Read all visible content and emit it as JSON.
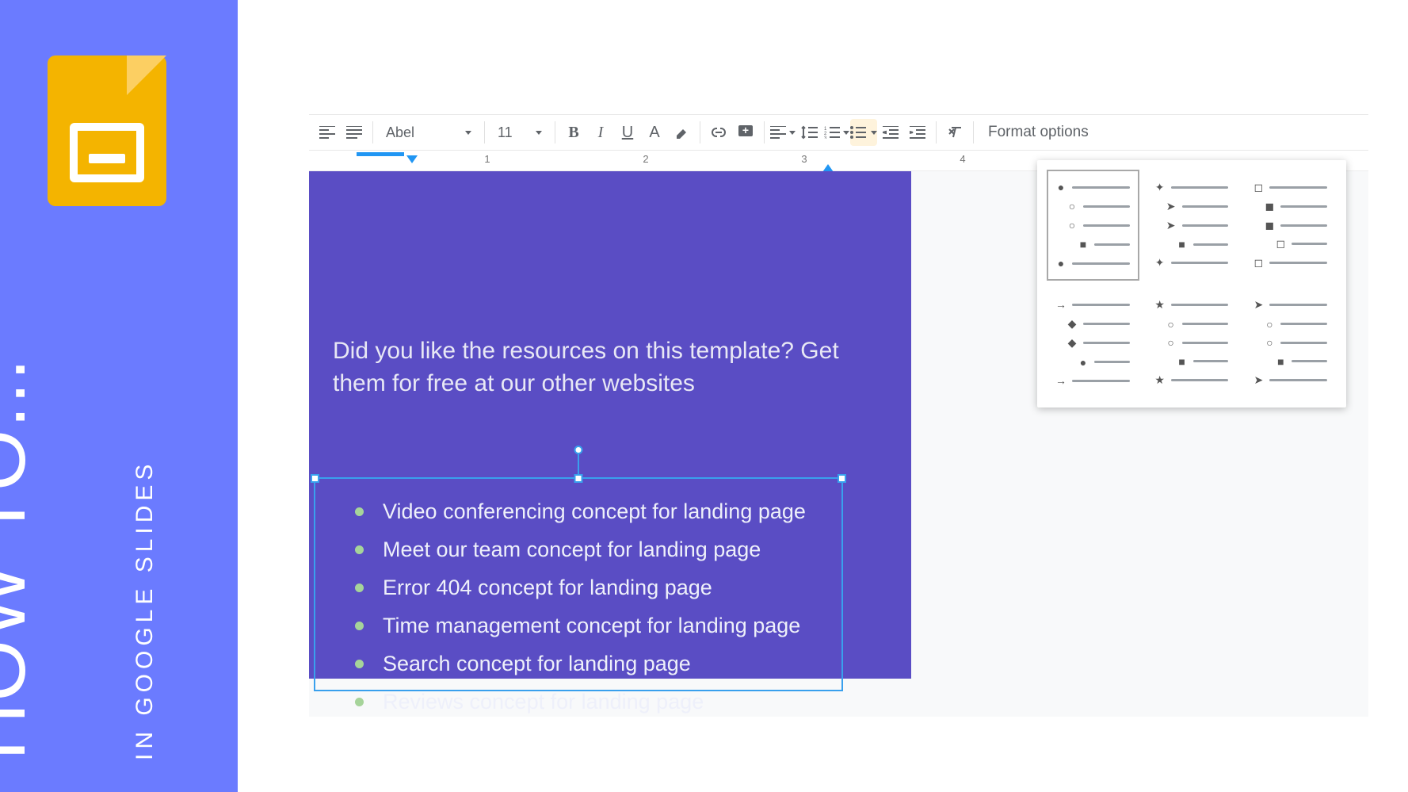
{
  "banner": {
    "title": "HOW TO...",
    "subtitle": "IN GOOGLE SLIDES"
  },
  "toolbar": {
    "font": "Abel",
    "fontSize": "11",
    "formatOptions": "Format options"
  },
  "ruler": {
    "nums": [
      "1",
      "2",
      "3",
      "4"
    ]
  },
  "slide": {
    "heading": "Did you like the resources on this template? Get them for free at our other websites",
    "items": [
      "Video conferencing concept for landing page",
      "Meet our team concept for landing page",
      "Error 404 concept for landing page",
      "Time management concept for landing page",
      "Search concept for landing page",
      "Reviews concept for landing page"
    ]
  },
  "bulletStyles": [
    {
      "id": "disc-circle-square",
      "selected": true,
      "rows": [
        [
          "●",
          0
        ],
        [
          "○",
          1
        ],
        [
          "○",
          1
        ],
        [
          "■",
          2
        ],
        [
          "●",
          0
        ]
      ]
    },
    {
      "id": "diamond-arrow-square",
      "selected": false,
      "rows": [
        [
          "✦",
          0
        ],
        [
          "➤",
          1
        ],
        [
          "➤",
          1
        ],
        [
          "■",
          2
        ],
        [
          "✦",
          0
        ]
      ]
    },
    {
      "id": "box-square",
      "selected": false,
      "rows": [
        [
          "◻",
          0
        ],
        [
          "◼",
          1
        ],
        [
          "◼",
          1
        ],
        [
          "◻",
          2
        ],
        [
          "◻",
          0
        ]
      ]
    },
    {
      "id": "arrow-diamond-disc",
      "selected": false,
      "rows": [
        [
          "→",
          0
        ],
        [
          "◆",
          1
        ],
        [
          "◆",
          1
        ],
        [
          "●",
          2
        ],
        [
          "→",
          0
        ]
      ]
    },
    {
      "id": "star-circle-square",
      "selected": false,
      "rows": [
        [
          "★",
          0
        ],
        [
          "○",
          1
        ],
        [
          "○",
          1
        ],
        [
          "■",
          2
        ],
        [
          "★",
          0
        ]
      ]
    },
    {
      "id": "chevron-circle-square",
      "selected": false,
      "rows": [
        [
          "➤",
          0
        ],
        [
          "○",
          1
        ],
        [
          "○",
          1
        ],
        [
          "■",
          2
        ],
        [
          "➤",
          0
        ]
      ]
    }
  ]
}
